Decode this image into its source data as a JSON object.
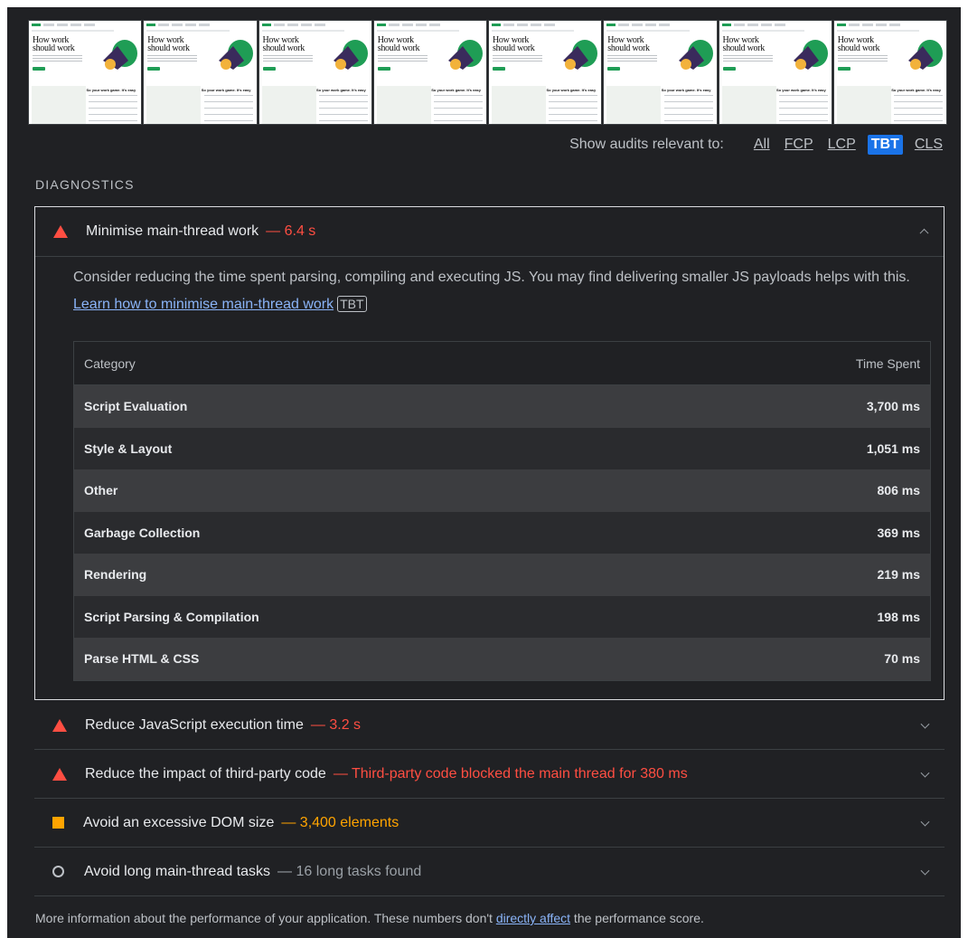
{
  "filmstrip": {
    "frames": [
      {
        "headline": "How work should work"
      },
      {
        "headline": "How work should work"
      },
      {
        "headline": "How work should work"
      },
      {
        "headline": "How work should work"
      },
      {
        "headline": "How work should work"
      },
      {
        "headline": "How work should work"
      },
      {
        "headline": "How work should work"
      },
      {
        "headline": "How work should work"
      }
    ],
    "lower_title": "So your work game. It's easy"
  },
  "filter": {
    "label": "Show audits relevant to:",
    "options": [
      "All",
      "FCP",
      "LCP",
      "TBT",
      "CLS"
    ],
    "active": "TBT"
  },
  "section_title": "DIAGNOSTICS",
  "expanded_audit": {
    "title": "Minimise main-thread work",
    "display_value": "— 6.4 s",
    "description_pre": "Consider reducing the time spent parsing, compiling and executing JS. You may find delivering smaller JS payloads helps with this.",
    "learn_link": "Learn how to minimise main-thread work",
    "badge": "TBT",
    "table": {
      "headers": [
        "Category",
        "Time Spent"
      ],
      "rows": [
        {
          "category": "Script Evaluation",
          "time": "3,700 ms"
        },
        {
          "category": "Style & Layout",
          "time": "1,051 ms"
        },
        {
          "category": "Other",
          "time": "806 ms"
        },
        {
          "category": "Garbage Collection",
          "time": "369 ms"
        },
        {
          "category": "Rendering",
          "time": "219 ms"
        },
        {
          "category": "Script Parsing & Compilation",
          "time": "198 ms"
        },
        {
          "category": "Parse HTML & CSS",
          "time": "70 ms"
        }
      ]
    }
  },
  "audits": [
    {
      "title": "Reduce JavaScript execution time",
      "display_value": "— 3.2 s",
      "status": "fail"
    },
    {
      "title": "Reduce the impact of third-party code",
      "display_value": "— Third-party code blocked the main thread for 380 ms",
      "status": "fail"
    },
    {
      "title": "Avoid an excessive DOM size",
      "display_value": "— 3,400 elements",
      "status": "average"
    },
    {
      "title": "Avoid long main-thread tasks",
      "display_value": "— 16 long tasks found",
      "status": "info"
    }
  ],
  "footer": {
    "pre": "More information about the performance of your application. These numbers don't ",
    "link": "directly affect",
    "post": " the performance score."
  },
  "colors": {
    "fail": "#ff4e42",
    "average": "#ffa400",
    "active_chip": "#1a73e8",
    "link": "#8ab4f8"
  }
}
